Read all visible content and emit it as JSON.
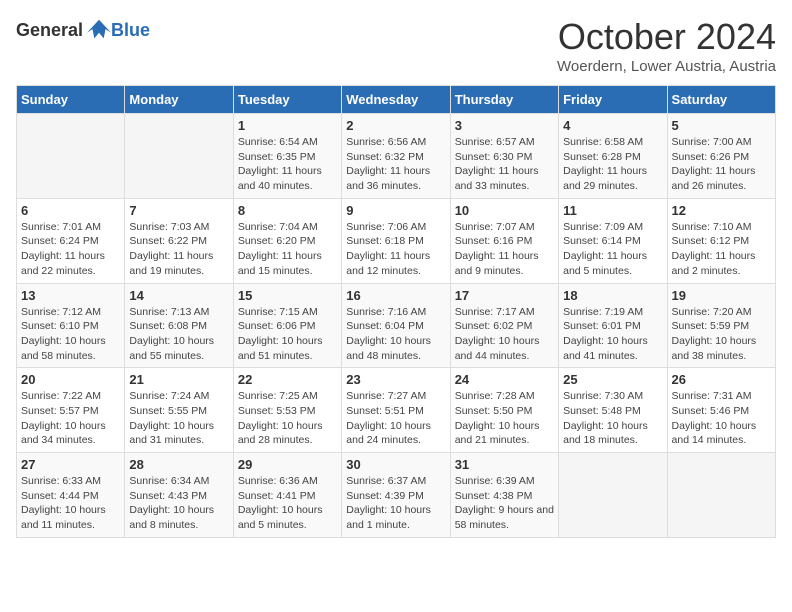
{
  "header": {
    "logo_general": "General",
    "logo_blue": "Blue",
    "month_title": "October 2024",
    "subtitle": "Woerdern, Lower Austria, Austria"
  },
  "days_of_week": [
    "Sunday",
    "Monday",
    "Tuesday",
    "Wednesday",
    "Thursday",
    "Friday",
    "Saturday"
  ],
  "weeks": [
    [
      {
        "day": "",
        "info": ""
      },
      {
        "day": "",
        "info": ""
      },
      {
        "day": "1",
        "info": "Sunrise: 6:54 AM\nSunset: 6:35 PM\nDaylight: 11 hours and 40 minutes."
      },
      {
        "day": "2",
        "info": "Sunrise: 6:56 AM\nSunset: 6:32 PM\nDaylight: 11 hours and 36 minutes."
      },
      {
        "day": "3",
        "info": "Sunrise: 6:57 AM\nSunset: 6:30 PM\nDaylight: 11 hours and 33 minutes."
      },
      {
        "day": "4",
        "info": "Sunrise: 6:58 AM\nSunset: 6:28 PM\nDaylight: 11 hours and 29 minutes."
      },
      {
        "day": "5",
        "info": "Sunrise: 7:00 AM\nSunset: 6:26 PM\nDaylight: 11 hours and 26 minutes."
      }
    ],
    [
      {
        "day": "6",
        "info": "Sunrise: 7:01 AM\nSunset: 6:24 PM\nDaylight: 11 hours and 22 minutes."
      },
      {
        "day": "7",
        "info": "Sunrise: 7:03 AM\nSunset: 6:22 PM\nDaylight: 11 hours and 19 minutes."
      },
      {
        "day": "8",
        "info": "Sunrise: 7:04 AM\nSunset: 6:20 PM\nDaylight: 11 hours and 15 minutes."
      },
      {
        "day": "9",
        "info": "Sunrise: 7:06 AM\nSunset: 6:18 PM\nDaylight: 11 hours and 12 minutes."
      },
      {
        "day": "10",
        "info": "Sunrise: 7:07 AM\nSunset: 6:16 PM\nDaylight: 11 hours and 9 minutes."
      },
      {
        "day": "11",
        "info": "Sunrise: 7:09 AM\nSunset: 6:14 PM\nDaylight: 11 hours and 5 minutes."
      },
      {
        "day": "12",
        "info": "Sunrise: 7:10 AM\nSunset: 6:12 PM\nDaylight: 11 hours and 2 minutes."
      }
    ],
    [
      {
        "day": "13",
        "info": "Sunrise: 7:12 AM\nSunset: 6:10 PM\nDaylight: 10 hours and 58 minutes."
      },
      {
        "day": "14",
        "info": "Sunrise: 7:13 AM\nSunset: 6:08 PM\nDaylight: 10 hours and 55 minutes."
      },
      {
        "day": "15",
        "info": "Sunrise: 7:15 AM\nSunset: 6:06 PM\nDaylight: 10 hours and 51 minutes."
      },
      {
        "day": "16",
        "info": "Sunrise: 7:16 AM\nSunset: 6:04 PM\nDaylight: 10 hours and 48 minutes."
      },
      {
        "day": "17",
        "info": "Sunrise: 7:17 AM\nSunset: 6:02 PM\nDaylight: 10 hours and 44 minutes."
      },
      {
        "day": "18",
        "info": "Sunrise: 7:19 AM\nSunset: 6:01 PM\nDaylight: 10 hours and 41 minutes."
      },
      {
        "day": "19",
        "info": "Sunrise: 7:20 AM\nSunset: 5:59 PM\nDaylight: 10 hours and 38 minutes."
      }
    ],
    [
      {
        "day": "20",
        "info": "Sunrise: 7:22 AM\nSunset: 5:57 PM\nDaylight: 10 hours and 34 minutes."
      },
      {
        "day": "21",
        "info": "Sunrise: 7:24 AM\nSunset: 5:55 PM\nDaylight: 10 hours and 31 minutes."
      },
      {
        "day": "22",
        "info": "Sunrise: 7:25 AM\nSunset: 5:53 PM\nDaylight: 10 hours and 28 minutes."
      },
      {
        "day": "23",
        "info": "Sunrise: 7:27 AM\nSunset: 5:51 PM\nDaylight: 10 hours and 24 minutes."
      },
      {
        "day": "24",
        "info": "Sunrise: 7:28 AM\nSunset: 5:50 PM\nDaylight: 10 hours and 21 minutes."
      },
      {
        "day": "25",
        "info": "Sunrise: 7:30 AM\nSunset: 5:48 PM\nDaylight: 10 hours and 18 minutes."
      },
      {
        "day": "26",
        "info": "Sunrise: 7:31 AM\nSunset: 5:46 PM\nDaylight: 10 hours and 14 minutes."
      }
    ],
    [
      {
        "day": "27",
        "info": "Sunrise: 6:33 AM\nSunset: 4:44 PM\nDaylight: 10 hours and 11 minutes."
      },
      {
        "day": "28",
        "info": "Sunrise: 6:34 AM\nSunset: 4:43 PM\nDaylight: 10 hours and 8 minutes."
      },
      {
        "day": "29",
        "info": "Sunrise: 6:36 AM\nSunset: 4:41 PM\nDaylight: 10 hours and 5 minutes."
      },
      {
        "day": "30",
        "info": "Sunrise: 6:37 AM\nSunset: 4:39 PM\nDaylight: 10 hours and 1 minute."
      },
      {
        "day": "31",
        "info": "Sunrise: 6:39 AM\nSunset: 4:38 PM\nDaylight: 9 hours and 58 minutes."
      },
      {
        "day": "",
        "info": ""
      },
      {
        "day": "",
        "info": ""
      }
    ]
  ]
}
